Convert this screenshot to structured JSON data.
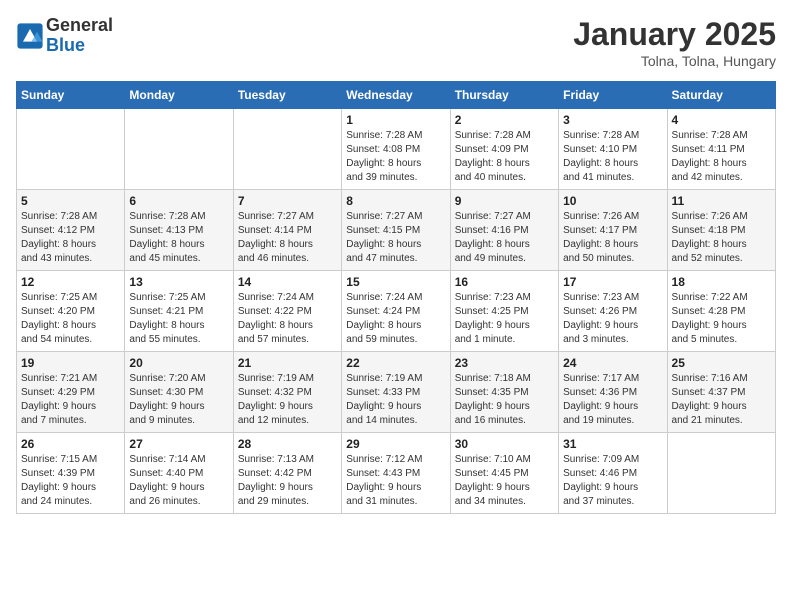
{
  "logo": {
    "general": "General",
    "blue": "Blue"
  },
  "header": {
    "month": "January 2025",
    "location": "Tolna, Tolna, Hungary"
  },
  "weekdays": [
    "Sunday",
    "Monday",
    "Tuesday",
    "Wednesday",
    "Thursday",
    "Friday",
    "Saturday"
  ],
  "weeks": [
    [
      {
        "day": "",
        "detail": ""
      },
      {
        "day": "",
        "detail": ""
      },
      {
        "day": "",
        "detail": ""
      },
      {
        "day": "1",
        "detail": "Sunrise: 7:28 AM\nSunset: 4:08 PM\nDaylight: 8 hours\nand 39 minutes."
      },
      {
        "day": "2",
        "detail": "Sunrise: 7:28 AM\nSunset: 4:09 PM\nDaylight: 8 hours\nand 40 minutes."
      },
      {
        "day": "3",
        "detail": "Sunrise: 7:28 AM\nSunset: 4:10 PM\nDaylight: 8 hours\nand 41 minutes."
      },
      {
        "day": "4",
        "detail": "Sunrise: 7:28 AM\nSunset: 4:11 PM\nDaylight: 8 hours\nand 42 minutes."
      }
    ],
    [
      {
        "day": "5",
        "detail": "Sunrise: 7:28 AM\nSunset: 4:12 PM\nDaylight: 8 hours\nand 43 minutes."
      },
      {
        "day": "6",
        "detail": "Sunrise: 7:28 AM\nSunset: 4:13 PM\nDaylight: 8 hours\nand 45 minutes."
      },
      {
        "day": "7",
        "detail": "Sunrise: 7:27 AM\nSunset: 4:14 PM\nDaylight: 8 hours\nand 46 minutes."
      },
      {
        "day": "8",
        "detail": "Sunrise: 7:27 AM\nSunset: 4:15 PM\nDaylight: 8 hours\nand 47 minutes."
      },
      {
        "day": "9",
        "detail": "Sunrise: 7:27 AM\nSunset: 4:16 PM\nDaylight: 8 hours\nand 49 minutes."
      },
      {
        "day": "10",
        "detail": "Sunrise: 7:26 AM\nSunset: 4:17 PM\nDaylight: 8 hours\nand 50 minutes."
      },
      {
        "day": "11",
        "detail": "Sunrise: 7:26 AM\nSunset: 4:18 PM\nDaylight: 8 hours\nand 52 minutes."
      }
    ],
    [
      {
        "day": "12",
        "detail": "Sunrise: 7:25 AM\nSunset: 4:20 PM\nDaylight: 8 hours\nand 54 minutes."
      },
      {
        "day": "13",
        "detail": "Sunrise: 7:25 AM\nSunset: 4:21 PM\nDaylight: 8 hours\nand 55 minutes."
      },
      {
        "day": "14",
        "detail": "Sunrise: 7:24 AM\nSunset: 4:22 PM\nDaylight: 8 hours\nand 57 minutes."
      },
      {
        "day": "15",
        "detail": "Sunrise: 7:24 AM\nSunset: 4:24 PM\nDaylight: 8 hours\nand 59 minutes."
      },
      {
        "day": "16",
        "detail": "Sunrise: 7:23 AM\nSunset: 4:25 PM\nDaylight: 9 hours\nand 1 minute."
      },
      {
        "day": "17",
        "detail": "Sunrise: 7:23 AM\nSunset: 4:26 PM\nDaylight: 9 hours\nand 3 minutes."
      },
      {
        "day": "18",
        "detail": "Sunrise: 7:22 AM\nSunset: 4:28 PM\nDaylight: 9 hours\nand 5 minutes."
      }
    ],
    [
      {
        "day": "19",
        "detail": "Sunrise: 7:21 AM\nSunset: 4:29 PM\nDaylight: 9 hours\nand 7 minutes."
      },
      {
        "day": "20",
        "detail": "Sunrise: 7:20 AM\nSunset: 4:30 PM\nDaylight: 9 hours\nand 9 minutes."
      },
      {
        "day": "21",
        "detail": "Sunrise: 7:19 AM\nSunset: 4:32 PM\nDaylight: 9 hours\nand 12 minutes."
      },
      {
        "day": "22",
        "detail": "Sunrise: 7:19 AM\nSunset: 4:33 PM\nDaylight: 9 hours\nand 14 minutes."
      },
      {
        "day": "23",
        "detail": "Sunrise: 7:18 AM\nSunset: 4:35 PM\nDaylight: 9 hours\nand 16 minutes."
      },
      {
        "day": "24",
        "detail": "Sunrise: 7:17 AM\nSunset: 4:36 PM\nDaylight: 9 hours\nand 19 minutes."
      },
      {
        "day": "25",
        "detail": "Sunrise: 7:16 AM\nSunset: 4:37 PM\nDaylight: 9 hours\nand 21 minutes."
      }
    ],
    [
      {
        "day": "26",
        "detail": "Sunrise: 7:15 AM\nSunset: 4:39 PM\nDaylight: 9 hours\nand 24 minutes."
      },
      {
        "day": "27",
        "detail": "Sunrise: 7:14 AM\nSunset: 4:40 PM\nDaylight: 9 hours\nand 26 minutes."
      },
      {
        "day": "28",
        "detail": "Sunrise: 7:13 AM\nSunset: 4:42 PM\nDaylight: 9 hours\nand 29 minutes."
      },
      {
        "day": "29",
        "detail": "Sunrise: 7:12 AM\nSunset: 4:43 PM\nDaylight: 9 hours\nand 31 minutes."
      },
      {
        "day": "30",
        "detail": "Sunrise: 7:10 AM\nSunset: 4:45 PM\nDaylight: 9 hours\nand 34 minutes."
      },
      {
        "day": "31",
        "detail": "Sunrise: 7:09 AM\nSunset: 4:46 PM\nDaylight: 9 hours\nand 37 minutes."
      },
      {
        "day": "",
        "detail": ""
      }
    ]
  ]
}
